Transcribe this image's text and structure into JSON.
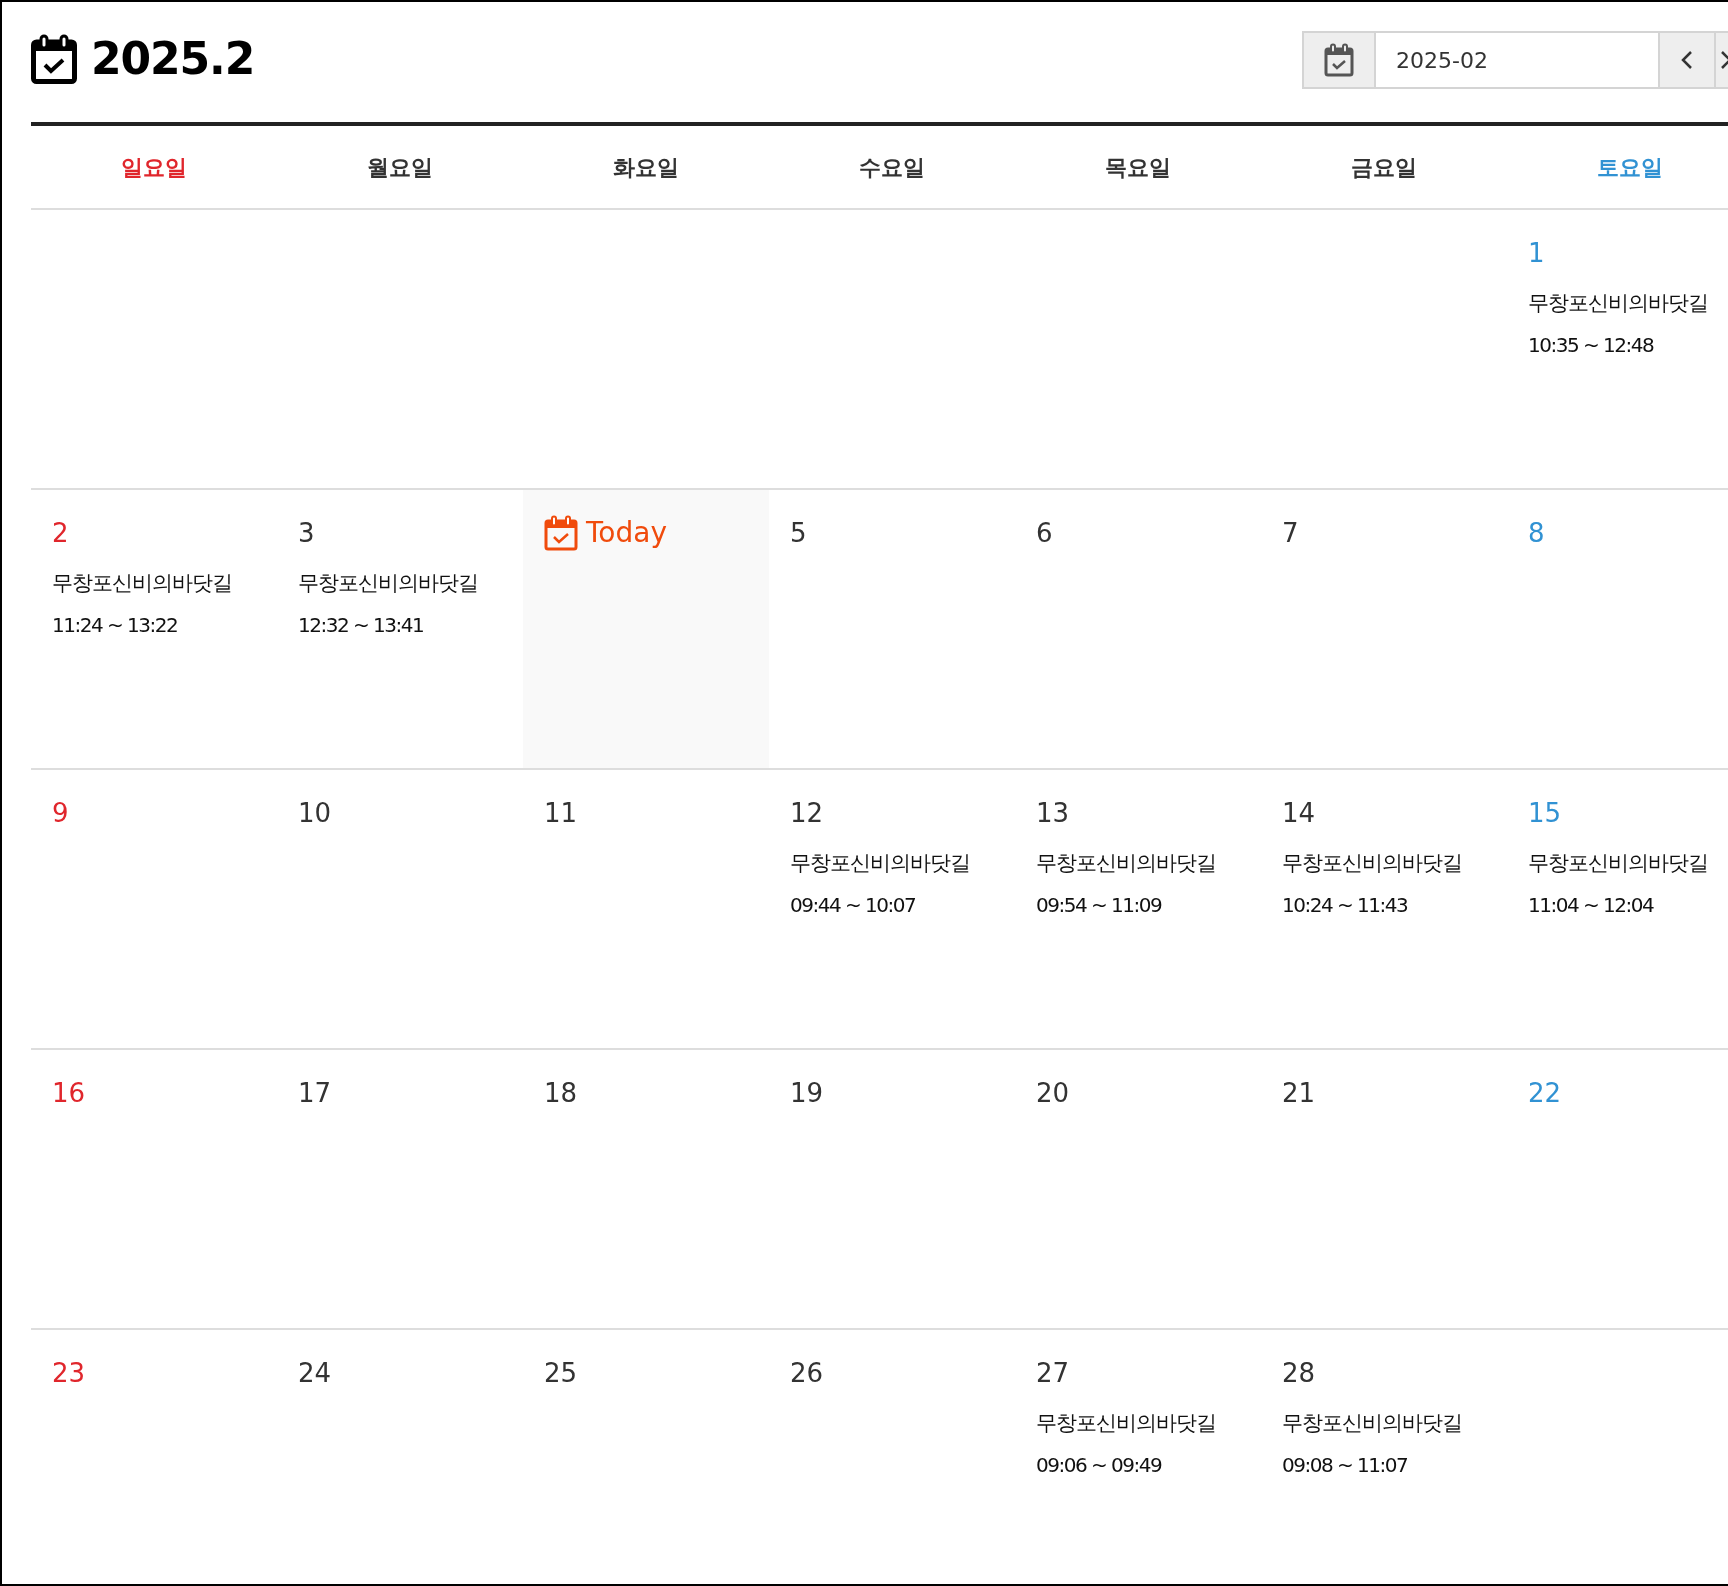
{
  "title": "2025.2",
  "month_picker": {
    "value": "2025-02"
  },
  "weekdays": [
    {
      "label": "일요일",
      "color": "#e0262c"
    },
    {
      "label": "월요일",
      "color": "#333333"
    },
    {
      "label": "화요일",
      "color": "#333333"
    },
    {
      "label": "수요일",
      "color": "#333333"
    },
    {
      "label": "목요일",
      "color": "#333333"
    },
    {
      "label": "금요일",
      "color": "#333333"
    },
    {
      "label": "토요일",
      "color": "#3192d3"
    }
  ],
  "weeks": [
    [
      {
        "kind": "empty"
      },
      {
        "kind": "empty"
      },
      {
        "kind": "empty"
      },
      {
        "kind": "empty"
      },
      {
        "kind": "empty"
      },
      {
        "kind": "empty"
      },
      {
        "kind": "day",
        "day": "1",
        "events": [
          {
            "title": "무창포신비의바닷길",
            "time": "10:35 ~ 12:48"
          }
        ]
      }
    ],
    [
      {
        "kind": "day",
        "day": "2",
        "events": [
          {
            "title": "무창포신비의바닷길",
            "time": "11:24 ~ 13:22"
          }
        ]
      },
      {
        "kind": "day",
        "day": "3",
        "events": [
          {
            "title": "무창포신비의바닷길",
            "time": "12:32 ~ 13:41"
          }
        ]
      },
      {
        "kind": "today",
        "label": "Today"
      },
      {
        "kind": "day",
        "day": "5"
      },
      {
        "kind": "day",
        "day": "6"
      },
      {
        "kind": "day",
        "day": "7"
      },
      {
        "kind": "day",
        "day": "8"
      }
    ],
    [
      {
        "kind": "day",
        "day": "9"
      },
      {
        "kind": "day",
        "day": "10"
      },
      {
        "kind": "day",
        "day": "11"
      },
      {
        "kind": "day",
        "day": "12",
        "events": [
          {
            "title": "무창포신비의바닷길",
            "time": "09:44 ~ 10:07"
          }
        ]
      },
      {
        "kind": "day",
        "day": "13",
        "events": [
          {
            "title": "무창포신비의바닷길",
            "time": "09:54 ~ 11:09"
          }
        ]
      },
      {
        "kind": "day",
        "day": "14",
        "events": [
          {
            "title": "무창포신비의바닷길",
            "time": "10:24 ~ 11:43"
          }
        ]
      },
      {
        "kind": "day",
        "day": "15",
        "events": [
          {
            "title": "무창포신비의바닷길",
            "time": "11:04 ~ 12:04"
          }
        ]
      }
    ],
    [
      {
        "kind": "day",
        "day": "16"
      },
      {
        "kind": "day",
        "day": "17"
      },
      {
        "kind": "day",
        "day": "18"
      },
      {
        "kind": "day",
        "day": "19"
      },
      {
        "kind": "day",
        "day": "20"
      },
      {
        "kind": "day",
        "day": "21"
      },
      {
        "kind": "day",
        "day": "22"
      }
    ],
    [
      {
        "kind": "day",
        "day": "23"
      },
      {
        "kind": "day",
        "day": "24"
      },
      {
        "kind": "day",
        "day": "25"
      },
      {
        "kind": "day",
        "day": "26"
      },
      {
        "kind": "day",
        "day": "27",
        "events": [
          {
            "title": "무창포신비의바닷길",
            "time": "09:06 ~ 09:49"
          }
        ]
      },
      {
        "kind": "day",
        "day": "28",
        "events": [
          {
            "title": "무창포신비의바닷길",
            "time": "09:08 ~ 11:07"
          }
        ]
      },
      {
        "kind": "empty"
      }
    ]
  ]
}
